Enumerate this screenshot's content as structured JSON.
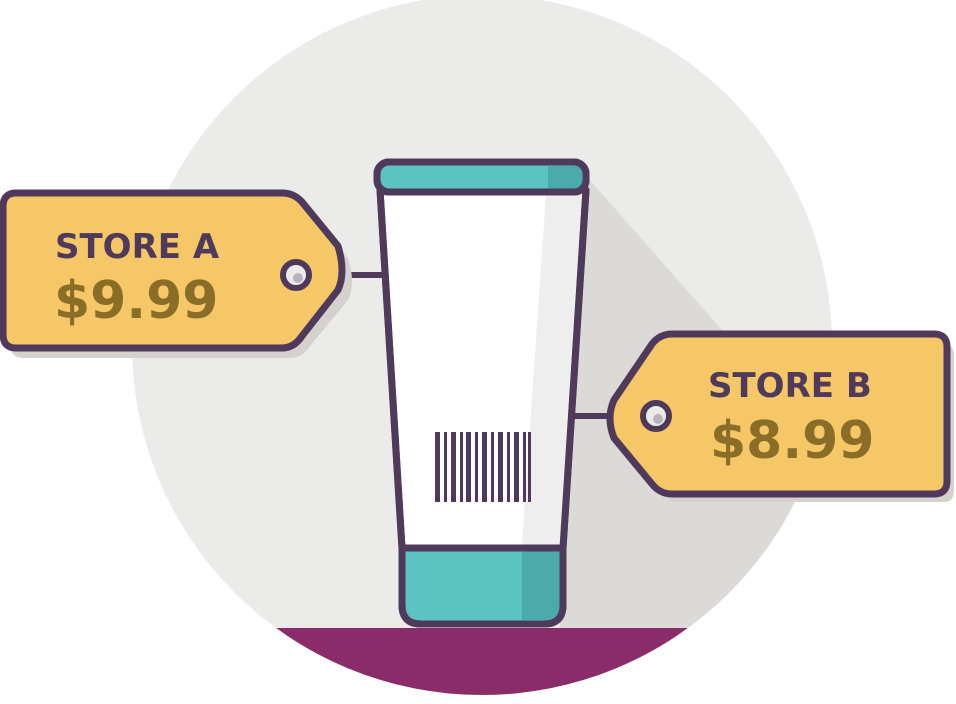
{
  "colors": {
    "background_circle": "#ebebea",
    "tube_shadow": "#dcdad6",
    "ground": "#8a2c69",
    "outline": "#4f3a5c",
    "tag_fill": "#f5c766",
    "tag_shadow": "#d5d1cc",
    "price_text": "#8a6e28",
    "tube_body": "#ffffff",
    "tube_cap": "#5bc4c1",
    "tube_cap_shade": "#4aabaa"
  },
  "tags": [
    {
      "store": "STORE A",
      "price": "$9.99"
    },
    {
      "store": "STORE B",
      "price": "$8.99"
    }
  ],
  "product": {
    "icon": "lotion-tube-icon",
    "barcode_icon": "barcode-icon"
  }
}
